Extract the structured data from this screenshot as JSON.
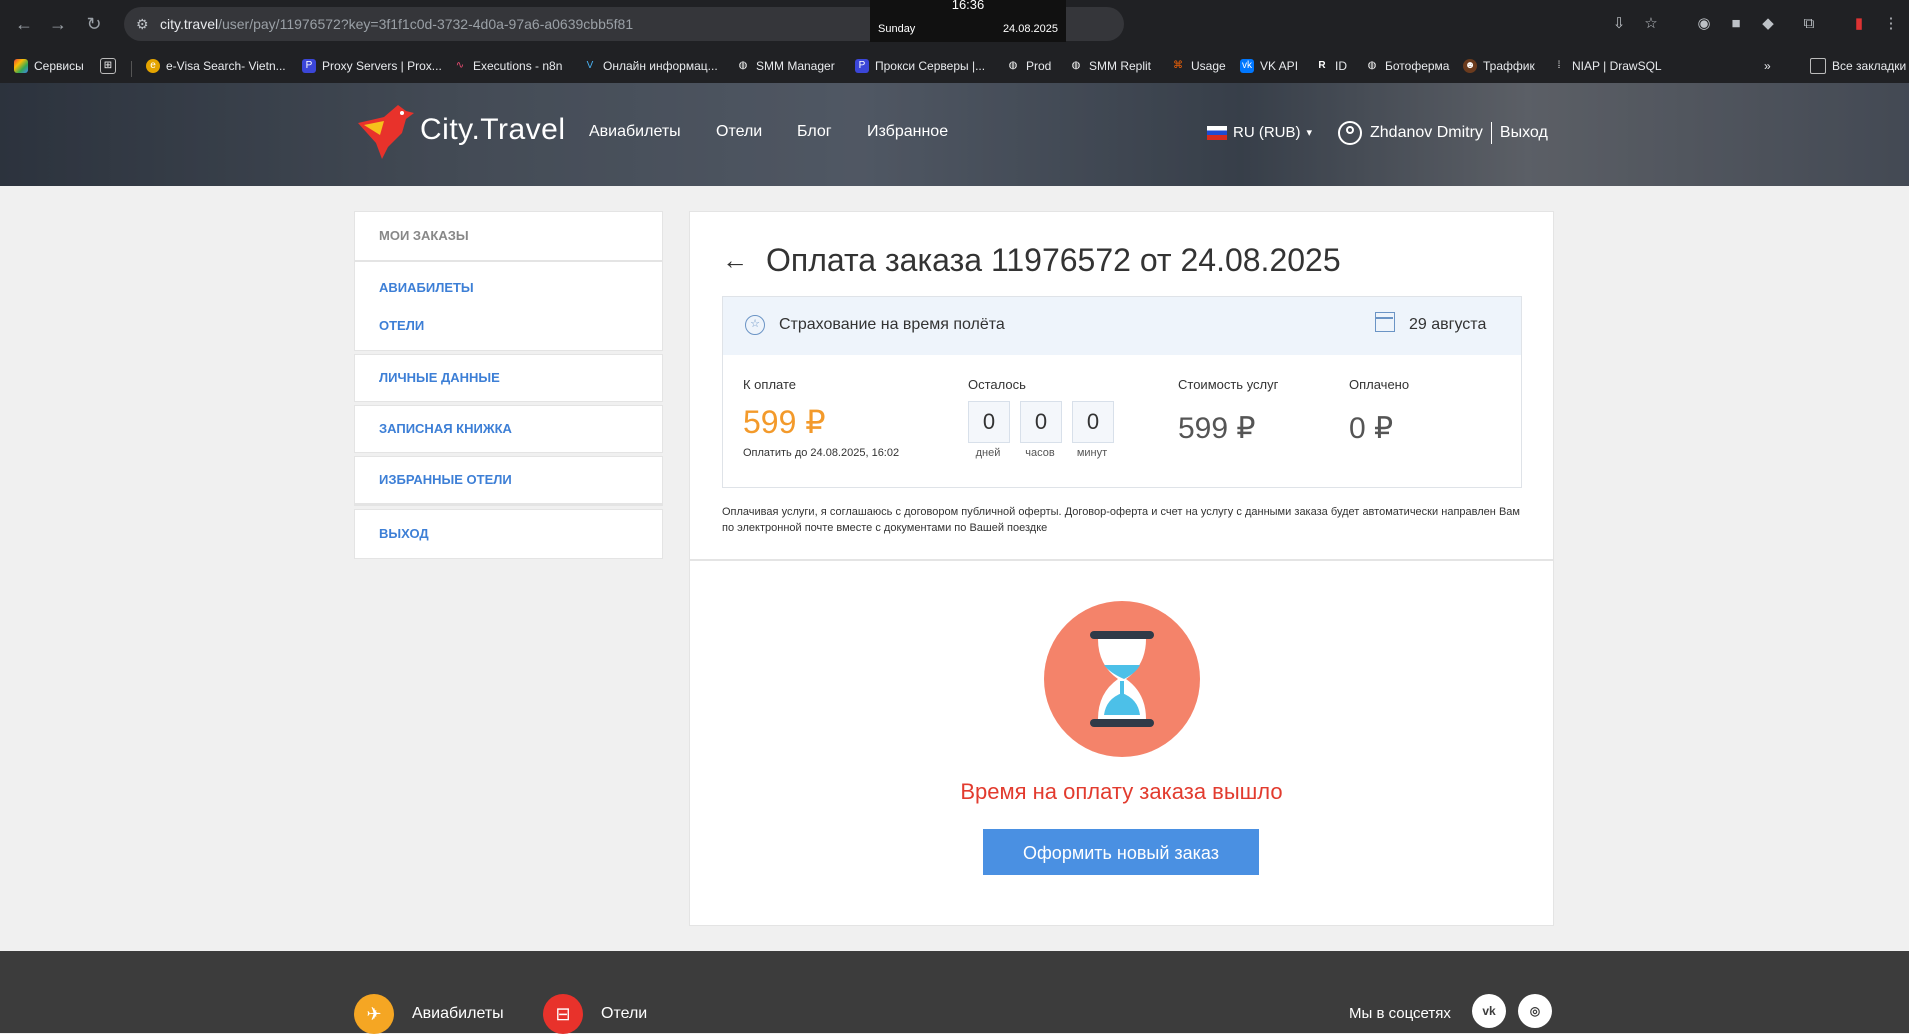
{
  "browser": {
    "url_host": "city.travel",
    "url_path": "/user/pay/11976572?key=3f1f1c0d-3732-4d0a-97a6-a0639cbb5f81",
    "clock_time": "16:36",
    "clock_day": "Sunday",
    "clock_date": "24.08.2025",
    "bookmarks": [
      "Сервисы",
      "e-Visa Search- Vietn...",
      "Proxy Servers | Prox...",
      "Executions - n8n",
      "Онлайн информац...",
      "SMM Manager",
      "Прокси Серверы |...",
      "Prod",
      "SMM Replit",
      "Usage",
      "VK API",
      "ID",
      "Ботоферма",
      "Траффик",
      "NIAP | DrawSQL"
    ],
    "all_bookmarks": "Все закладки"
  },
  "header": {
    "logo_text": "City.Travel",
    "nav": [
      "Авиабилеты",
      "Отели",
      "Блог",
      "Избранное"
    ],
    "language": "RU (RUB)",
    "user_name": "Zhdanov Dmitry",
    "logout": "Выход"
  },
  "sidebar": {
    "my_orders": "МОИ ЗАКАЗЫ",
    "flights": "АВИАБИЛЕТЫ",
    "hotels": "ОТЕЛИ",
    "personal": "ЛИЧНЫЕ ДАННЫЕ",
    "notebook": "ЗАПИСНАЯ КНИЖКА",
    "fav_hotels": "ИЗБРАННЫЕ ОТЕЛИ",
    "exit": "ВЫХОД"
  },
  "order": {
    "title": "Оплата заказа 11976572 от 24.08.2025",
    "insurance_label": "Страхование на время полёта",
    "service_date": "29 августа",
    "to_pay_label": "К оплате",
    "to_pay_amount": "599 ₽",
    "pay_until": "Оплатить до 24.08.2025, 16:02",
    "remaining_label": "Осталось",
    "days_value": "0",
    "hours_value": "0",
    "minutes_value": "0",
    "days_label": "дней",
    "hours_label": "часов",
    "minutes_label": "минут",
    "cost_label": "Стоимость услуг",
    "cost_amount": "599 ₽",
    "paid_label": "Оплачено",
    "paid_amount": "0 ₽",
    "offer_text": "Оплачивая услуги, я соглашаюсь с договором публичной оферты. Договор-оферта и счет на услугу с данными заказа будет автоматически направлен Вам по электронной почте вместе с документами по Вашей поездке",
    "expired_text": "Время на оплату заказа вышло",
    "new_order_button": "Оформить новый заказ"
  },
  "footer": {
    "flights": "Авиабилеты",
    "hotels": "Отели",
    "social_label": "Мы в соцсетях"
  },
  "colors": {
    "accent_blue": "#4a90e2",
    "price_orange": "#f39a2b",
    "expired_red": "#e23b2e",
    "hourglass_bg": "#f4836a"
  }
}
